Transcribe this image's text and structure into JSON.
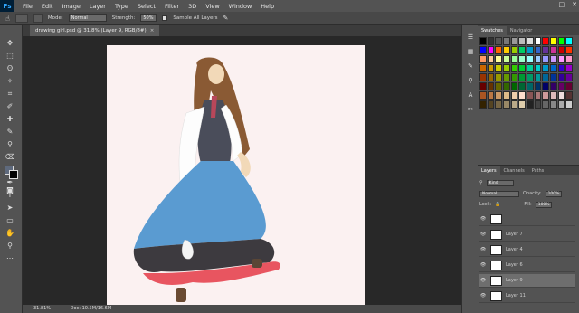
{
  "app": {
    "logo": "Ps"
  },
  "menu": [
    "File",
    "Edit",
    "Image",
    "Layer",
    "Type",
    "Select",
    "Filter",
    "3D",
    "View",
    "Window",
    "Help"
  ],
  "window_controls": [
    "–",
    "□",
    "✕"
  ],
  "options_bar": {
    "mode_label": "Mode:",
    "mode_value": "Normal",
    "strength_label": "Strength:",
    "strength_value": "50%",
    "sample_all_layers": "Sample All Layers"
  },
  "document": {
    "tab_title": "drawing girl.psd @ 31.8% (Layer 9, RGB/8#)",
    "close": "×"
  },
  "status": {
    "zoom": "31.81%",
    "doc": "Doc: 10.5M/16.6M"
  },
  "panels": {
    "swatch_tabs": [
      "Swatches",
      "Navigator"
    ],
    "layer_tabs": [
      "Layers",
      "Channels",
      "Paths"
    ],
    "kind_label": "Kind",
    "blend_mode": "Normal",
    "opacity_label": "Opacity:",
    "opacity_value": "100%",
    "lock_label": "Lock:",
    "fill_label": "Fill:",
    "fill_value": "100%",
    "layers": [
      {
        "name": "",
        "selected": false
      },
      {
        "name": "Layer 7",
        "selected": false
      },
      {
        "name": "Layer 4",
        "selected": false
      },
      {
        "name": "Layer 6",
        "selected": false
      },
      {
        "name": "Layer 9",
        "selected": true
      },
      {
        "name": "Layer 11",
        "selected": false
      }
    ]
  },
  "colors": {
    "skirt_blue": "#5a9bd1",
    "skirt_dark": "#3d3a3f",
    "skirt_red": "#e85560",
    "hair": "#8a5a34",
    "canvas": "#fbf1f1"
  }
}
